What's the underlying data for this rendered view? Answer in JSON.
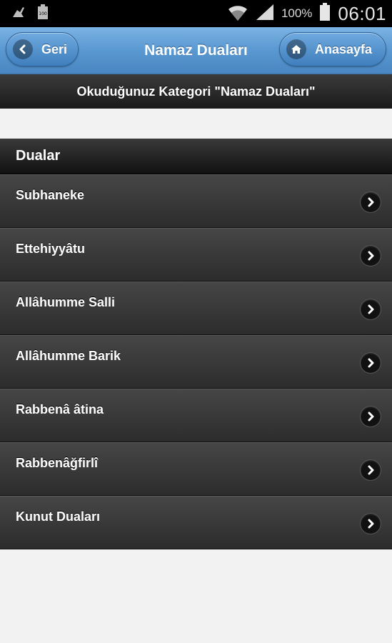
{
  "status_bar": {
    "battery_percent": "100%",
    "time": "06:01",
    "battery_badge": "100"
  },
  "header": {
    "back_label": "Geri",
    "title": "Namaz Duaları",
    "home_label": "Anasayfa"
  },
  "category": {
    "text": "Okuduğunuz Kategori \"Namaz Duaları\""
  },
  "list": {
    "header": "Dualar",
    "items": [
      {
        "label": "Subhaneke"
      },
      {
        "label": "Ettehiyyâtu"
      },
      {
        "label": "Allâhumme Salli"
      },
      {
        "label": "Allâhumme Barik"
      },
      {
        "label": "Rabbenâ âtina"
      },
      {
        "label": "Rabbenâğfirlî"
      },
      {
        "label": "Kunut Duaları"
      }
    ]
  },
  "colors": {
    "header_blue": "#5a98d1",
    "list_dark": "#3a3a3a",
    "background": "#f2f2f2"
  }
}
